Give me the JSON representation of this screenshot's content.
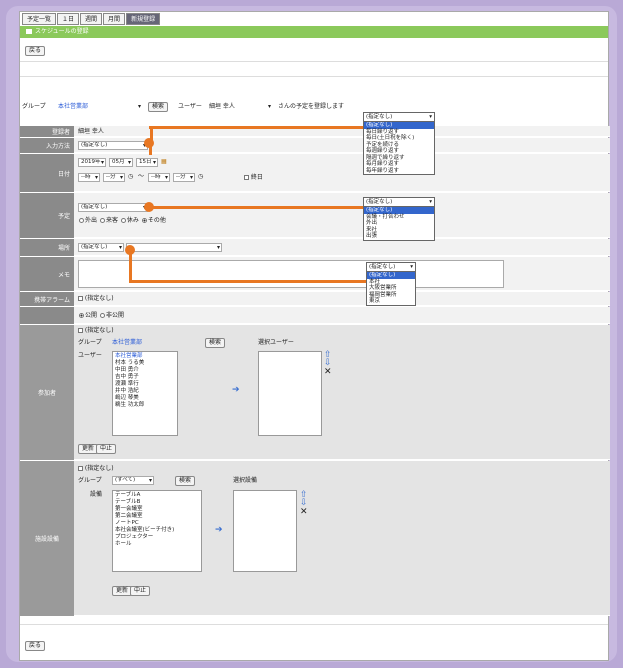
{
  "tabs": [
    "予定一覧",
    "１日",
    "週間",
    "月間",
    "新規登録"
  ],
  "title": "スケジュールの登録",
  "back_label": "戻る",
  "group_row": {
    "group_label": "グループ",
    "group_value": "本社営業部",
    "search_label": "検索",
    "user_label": "ユーザー",
    "user_value": "細垣 幸人",
    "suffix": "さんの予定を登録します"
  },
  "labels": {
    "registrant": "登録者",
    "input_method": "入力方法",
    "datetime": "日付",
    "schedule": "予定",
    "place": "場所",
    "memo": "メモ",
    "mobile": "携帯アラーム",
    "public": "",
    "participants": "参加者",
    "facility": "施設設備"
  },
  "registrant_value": "細垣 幸人",
  "input_method_value": "(指定なし)",
  "date": {
    "year": "2019年",
    "month": "05月",
    "day": "15日",
    "h1": "--時",
    "m1": "--分",
    "sep": "〜",
    "h2": "--時",
    "m2": "--分",
    "allday": "終日"
  },
  "schedule_value": "(指定なし)",
  "schedule_radios": [
    "外出",
    "来客",
    "休み",
    "その他"
  ],
  "place_value": "(指定なし)",
  "mobile_value": "(指定なし)",
  "public_radios": [
    "公開",
    "非公開"
  ],
  "participants": {
    "none": "(指定なし)",
    "group_label": "グループ",
    "group_value": "本社営業部",
    "search": "検索",
    "user_label": "ユーザー",
    "selected_label": "選択ユーザー",
    "users": [
      "本社営業部",
      "村本 うる美",
      "中田 勇介",
      "吉中 勇子",
      "渡瀬 準行",
      "井中 浩紀",
      "嶋辺 琴美",
      "鵜生 功太郎"
    ],
    "update": "更新",
    "cancel": "中止"
  },
  "facility": {
    "none": "(指定なし)",
    "group_label": "グループ",
    "group_value": "(すべて)",
    "search": "検索",
    "equip_label": "設備",
    "selected_label": "選択設備",
    "items": [
      "テーブルA",
      "テーブルB",
      "第一会議室",
      "第二会議室",
      "ノートPC",
      "本社会議室(ビーチ付き)",
      "プロジェクター",
      "ホール"
    ],
    "update": "更新",
    "cancel": "中止"
  },
  "dropdown1": {
    "head": "(指定なし)",
    "options": [
      "(指定なし)",
      "毎日繰り返す",
      "毎日(土日祝を除く)",
      "予定を続ける",
      "毎週繰り返す",
      "隔週で繰り返す",
      "毎月繰り返す",
      "毎年繰り返す"
    ]
  },
  "dropdown2": {
    "head": "(指定なし)",
    "options": [
      "(指定なし)",
      "会議・打合わせ",
      "外出",
      "来社",
      "出張"
    ]
  },
  "dropdown3": {
    "head": "(指定なし)",
    "options": [
      "(指定なし)",
      "本社",
      "大阪営業所",
      "福岡営業所",
      "東京"
    ]
  },
  "accent": "#e87722"
}
